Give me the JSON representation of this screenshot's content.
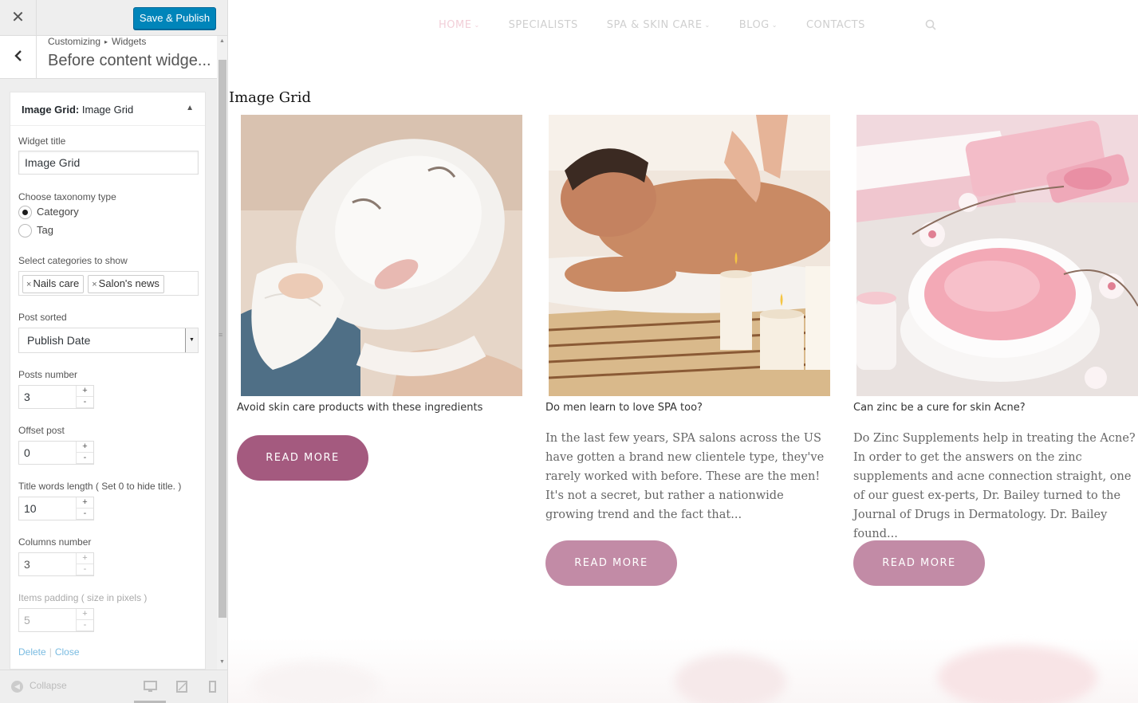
{
  "customizer": {
    "close_icon": "✕",
    "save_label": "Save & Publish",
    "back_icon": "‹",
    "breadcrumb": [
      "Customizing",
      "Widgets"
    ],
    "breadcrumb_sep": "▸",
    "section_title": "Before content widge...",
    "widget": {
      "header_bold": "Image Grid:",
      "header_name": "Image Grid",
      "toggle_icon": "▲",
      "widget_title_label": "Widget title",
      "widget_title_value": "Image Grid",
      "taxonomy_label": "Choose taxonomy type",
      "taxonomy_options": [
        "Category",
        "Tag"
      ],
      "taxonomy_selected": "Category",
      "categories_label": "Select categories to show",
      "categories": [
        "Nails care",
        "Salon's news"
      ],
      "sort_label": "Post sorted",
      "sort_value": "Publish Date",
      "posts_number_label": "Posts number",
      "posts_number": "3",
      "offset_label": "Offset post",
      "offset": "0",
      "title_words_label": "Title words length ( Set 0 to hide title. )",
      "title_words": "10",
      "columns_label": "Columns number",
      "columns": "3",
      "padding_label": "Items padding ( size in pixels )",
      "padding": "5",
      "delete_label": "Delete",
      "close_label": "Close",
      "link_sep": "|"
    },
    "footer": {
      "collapse_label": "Collapse",
      "collapse_icon": "◀",
      "devices": [
        "desktop-icon",
        "tablet-icon",
        "mobile-icon"
      ]
    }
  },
  "preview": {
    "nav": [
      "HOME",
      "SPECIALISTS",
      "SPA & SKIN CARE",
      "BLOG",
      "CONTACTS"
    ],
    "nav_chevron": "⌄",
    "grid_title": "Image Grid",
    "posts": [
      {
        "title": "Avoid skin care products with these ingredients",
        "excerpt": "",
        "button": "READ MORE"
      },
      {
        "title": "Do men learn to love SPA too?",
        "excerpt": "In the last few years, SPA salons across the US have gotten a brand new clientele type, they've rarely worked with before. These are the men! It's not a secret, but rather a nationwide growing trend and the fact that...",
        "button": "READ MORE"
      },
      {
        "title": "Can zinc be a cure for skin Acne?",
        "excerpt": "Do Zinc Supplements help in treating the Acne? In order to get the answers on the zinc supplements and acne connection straight, one of our guest ex-perts, Dr. Bailey turned to the Journal of Drugs in Dermatology. Dr. Bailey found...",
        "button": "READ MORE"
      }
    ],
    "colors": {
      "button_primary": "#a45a7f",
      "button_secondary": "#c28ba6",
      "nav_active": "#f2cfd8",
      "nav_text": "#cfcfcf"
    }
  }
}
